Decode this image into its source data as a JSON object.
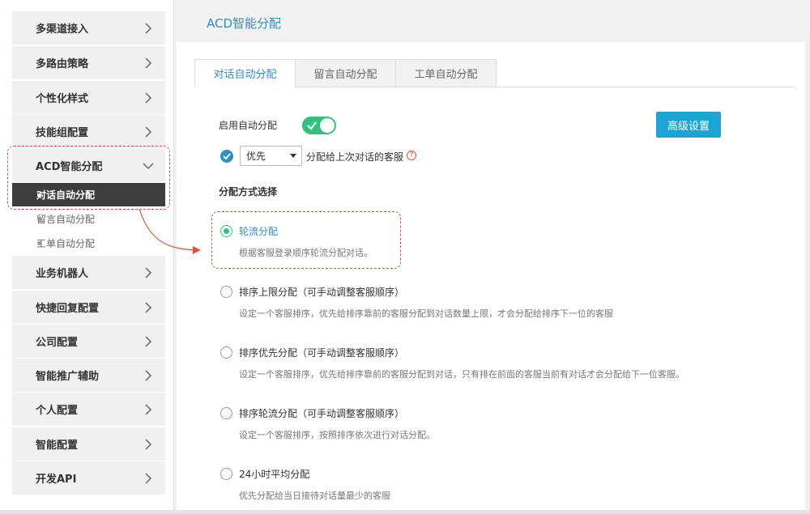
{
  "sidebar": {
    "items": [
      {
        "label": "多渠道接入"
      },
      {
        "label": "多路由策略"
      },
      {
        "label": "个性化样式"
      },
      {
        "label": "技能组配置"
      },
      {
        "label": "ACD智能分配"
      },
      {
        "label": "业务机器人"
      },
      {
        "label": "快捷回复配置"
      },
      {
        "label": "公司配置"
      },
      {
        "label": "智能推广辅助"
      },
      {
        "label": "个人配置"
      },
      {
        "label": "智能配置"
      },
      {
        "label": "开发API"
      }
    ],
    "acd_sub": [
      {
        "label": "对话自动分配"
      },
      {
        "label": "留言自动分配"
      },
      {
        "label": "工单自动分配"
      }
    ]
  },
  "header": {
    "title": "ACD智能分配"
  },
  "tabs": [
    {
      "label": "对话自动分配"
    },
    {
      "label": "留言自动分配"
    },
    {
      "label": "工单自动分配"
    }
  ],
  "settings": {
    "enable_label": "启用自动分配",
    "advanced_button": "高级设置",
    "prefer_select_value": "优先",
    "prefer_text": "分配给上次对话的客服",
    "help_glyph": "?"
  },
  "section": {
    "title": "分配方式选择"
  },
  "options": [
    {
      "title": "轮流分配",
      "desc": "根据客服登录顺序轮流分配对话。"
    },
    {
      "title": "排序上限分配（可手动调整客服顺序）",
      "desc": "设定一个客服排序，优先给排序靠前的客服分配到对话数量上限，才会分配给排序下一位的客服"
    },
    {
      "title": "排序优先分配（可手动调整客服顺序）",
      "desc": "设定一个客服排序，优先给排序靠前的客服分配到对话，只有排在前面的客服当前有对话才会分配给下一位客服。"
    },
    {
      "title": "排序轮流分配（可手动调整客服顺序）",
      "desc": "设定一个客服排序，按照排序依次进行对话分配。"
    },
    {
      "title": "24小时平均分配",
      "desc": "优先分配给当日接待对话量最少的客服"
    }
  ],
  "colors": {
    "accent": "#2e8fc2",
    "toggle_on": "#2ec27e",
    "button": "#1ea3d5",
    "highlight": "#e0533a"
  }
}
